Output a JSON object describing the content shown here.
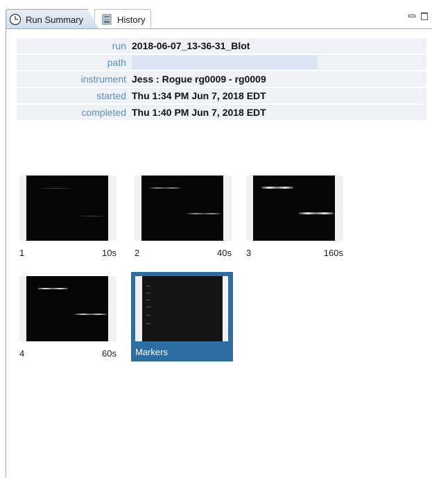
{
  "tabs": [
    {
      "label": "Run Summary",
      "icon": "clock-icon",
      "active": true
    },
    {
      "label": "History",
      "icon": "database-icon",
      "active": false
    }
  ],
  "window_controls": {
    "minimize_icon": "minimize-icon",
    "maximize_icon": "maximize-icon"
  },
  "properties": [
    {
      "key": "run",
      "value": "2018-06-07_13-36-31_Blot"
    },
    {
      "key": "path",
      "value": ""
    },
    {
      "key": "instrument",
      "value": "Jess : Rogue rg0009 - rg0009"
    },
    {
      "key": "started",
      "value": "Thu 1:34 PM Jun 7, 2018 EDT"
    },
    {
      "key": "completed",
      "value": "Thu 1:40 PM Jun 7, 2018 EDT"
    }
  ],
  "thumbnails": [
    {
      "index": "1",
      "exposure": "10s",
      "selected": false
    },
    {
      "index": "2",
      "exposure": "40s",
      "selected": false
    },
    {
      "index": "3",
      "exposure": "160s",
      "selected": false
    },
    {
      "index": "4",
      "exposure": "60s",
      "selected": false
    },
    {
      "index": "Markers",
      "exposure": "",
      "selected": true
    }
  ],
  "colors": {
    "key_text": "#5f8fb5",
    "selected_bg": "#2c6ea3",
    "row_bg": "#eef1f5"
  }
}
